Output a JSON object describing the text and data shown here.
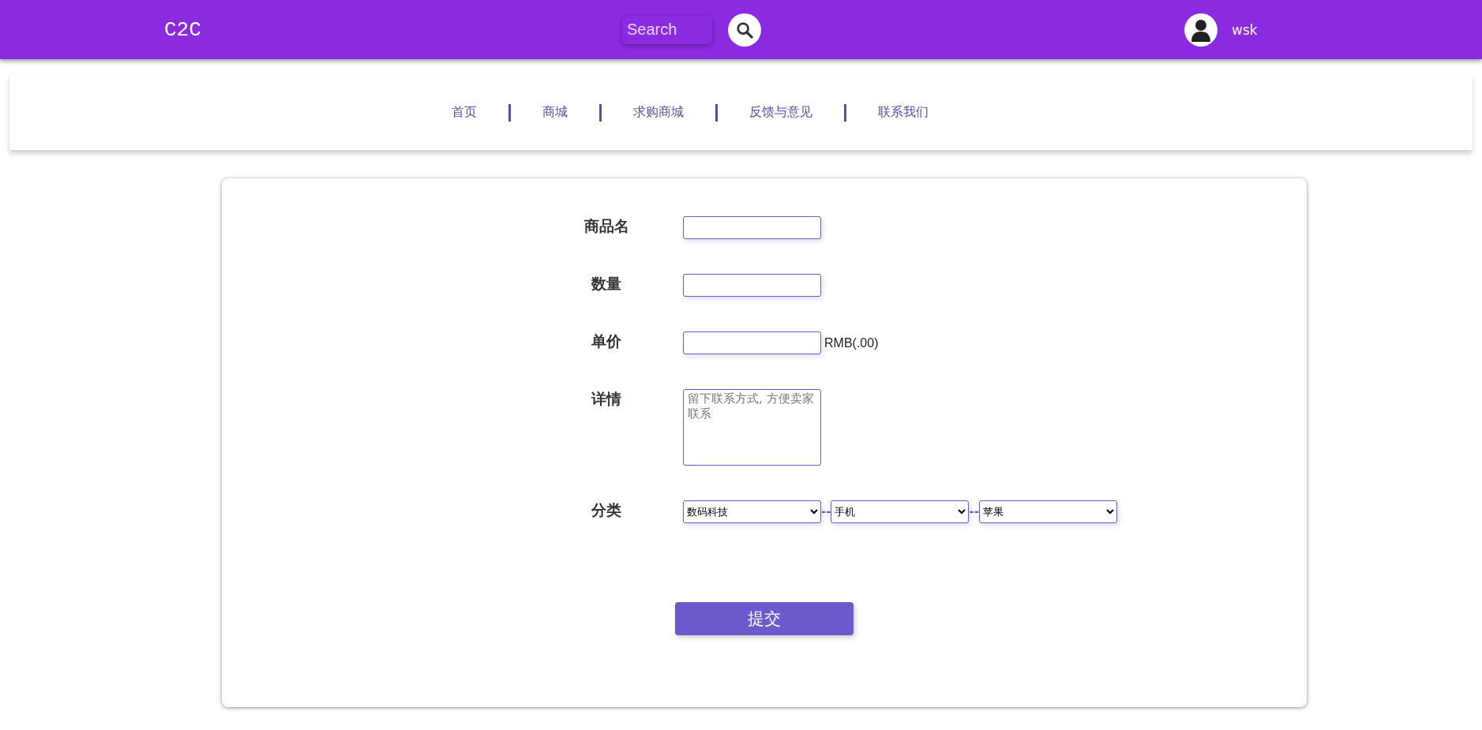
{
  "header": {
    "logo": "C2C",
    "search": {
      "placeholder": "Search"
    },
    "user": {
      "name": "wsk"
    }
  },
  "nav": {
    "items": [
      {
        "label": "首页"
      },
      {
        "label": "商城"
      },
      {
        "label": "求购商城"
      },
      {
        "label": "反馈与意见"
      },
      {
        "label": "联系我们"
      }
    ]
  },
  "form": {
    "fields": [
      {
        "kind": "text",
        "label": "商品名"
      },
      {
        "kind": "text",
        "label": "数量"
      },
      {
        "kind": "text",
        "label": "单价",
        "suffix": "RMB(.00)"
      },
      {
        "kind": "textarea",
        "label": "详情",
        "placeholder": "留下联系方式, 方便卖家联系"
      },
      {
        "kind": "selects",
        "label": "分类",
        "separator": "--",
        "selects": [
          "数码科技",
          "手机",
          "苹果"
        ]
      }
    ],
    "submit": "提交"
  }
}
